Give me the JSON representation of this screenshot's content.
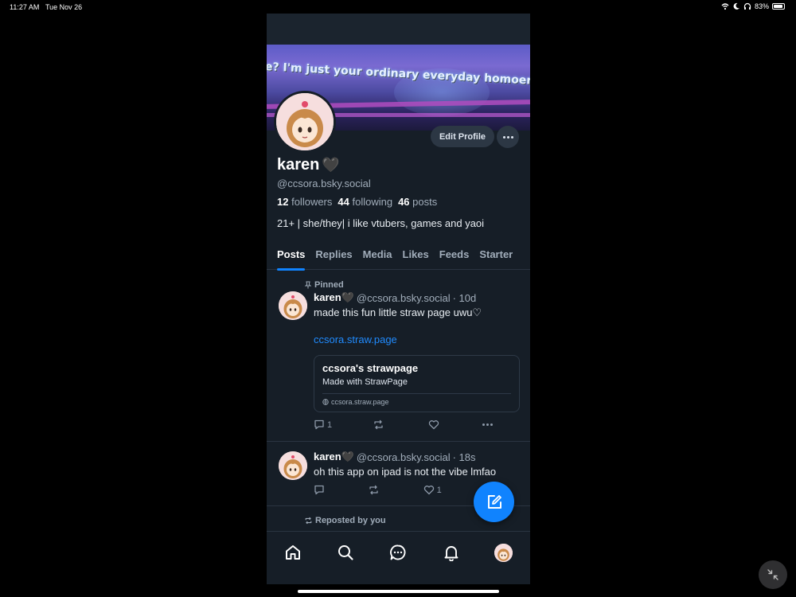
{
  "status_bar": {
    "time": "11:27 AM",
    "date": "Tue Nov 26",
    "battery": "83%"
  },
  "banner": {
    "text": "e? I'm just your ordinary everyday homoerotic connoisse"
  },
  "profile": {
    "display_name": "karen",
    "name_emoji": "🖤",
    "handle": "@ccsora.bsky.social",
    "followers_count": "12",
    "followers_label": "followers",
    "following_count": "44",
    "following_label": "following",
    "posts_count": "46",
    "posts_label": "posts",
    "bio": "21+ | she/they| i like vtubers, games and yaoi",
    "edit_profile_label": "Edit Profile"
  },
  "tabs": [
    "Posts",
    "Replies",
    "Media",
    "Likes",
    "Feeds",
    "Starter"
  ],
  "posts": [
    {
      "context": "Pinned",
      "author": "karen🖤",
      "handle": "@ccsora.bsky.social",
      "time": "· 10d",
      "text": "made this fun little straw page uwu♡",
      "link": "ccsora.straw.page",
      "card": {
        "title": "ccsora's strawpage",
        "subtitle": "Made with StrawPage",
        "domain": "ccsora.straw.page"
      },
      "reply_count": "1",
      "repost_count": "",
      "like_count": ""
    },
    {
      "context": "",
      "author": "karen🖤",
      "handle": "@ccsora.bsky.social",
      "time": "· 18s",
      "text": "oh this app on ipad is not the vibe lmfao",
      "reply_count": "",
      "repost_count": "",
      "like_count": "1"
    },
    {
      "context": "Reposted by you"
    }
  ],
  "colors": {
    "accent": "#1083fe",
    "background": "#161e27",
    "link": "#208bfe"
  }
}
